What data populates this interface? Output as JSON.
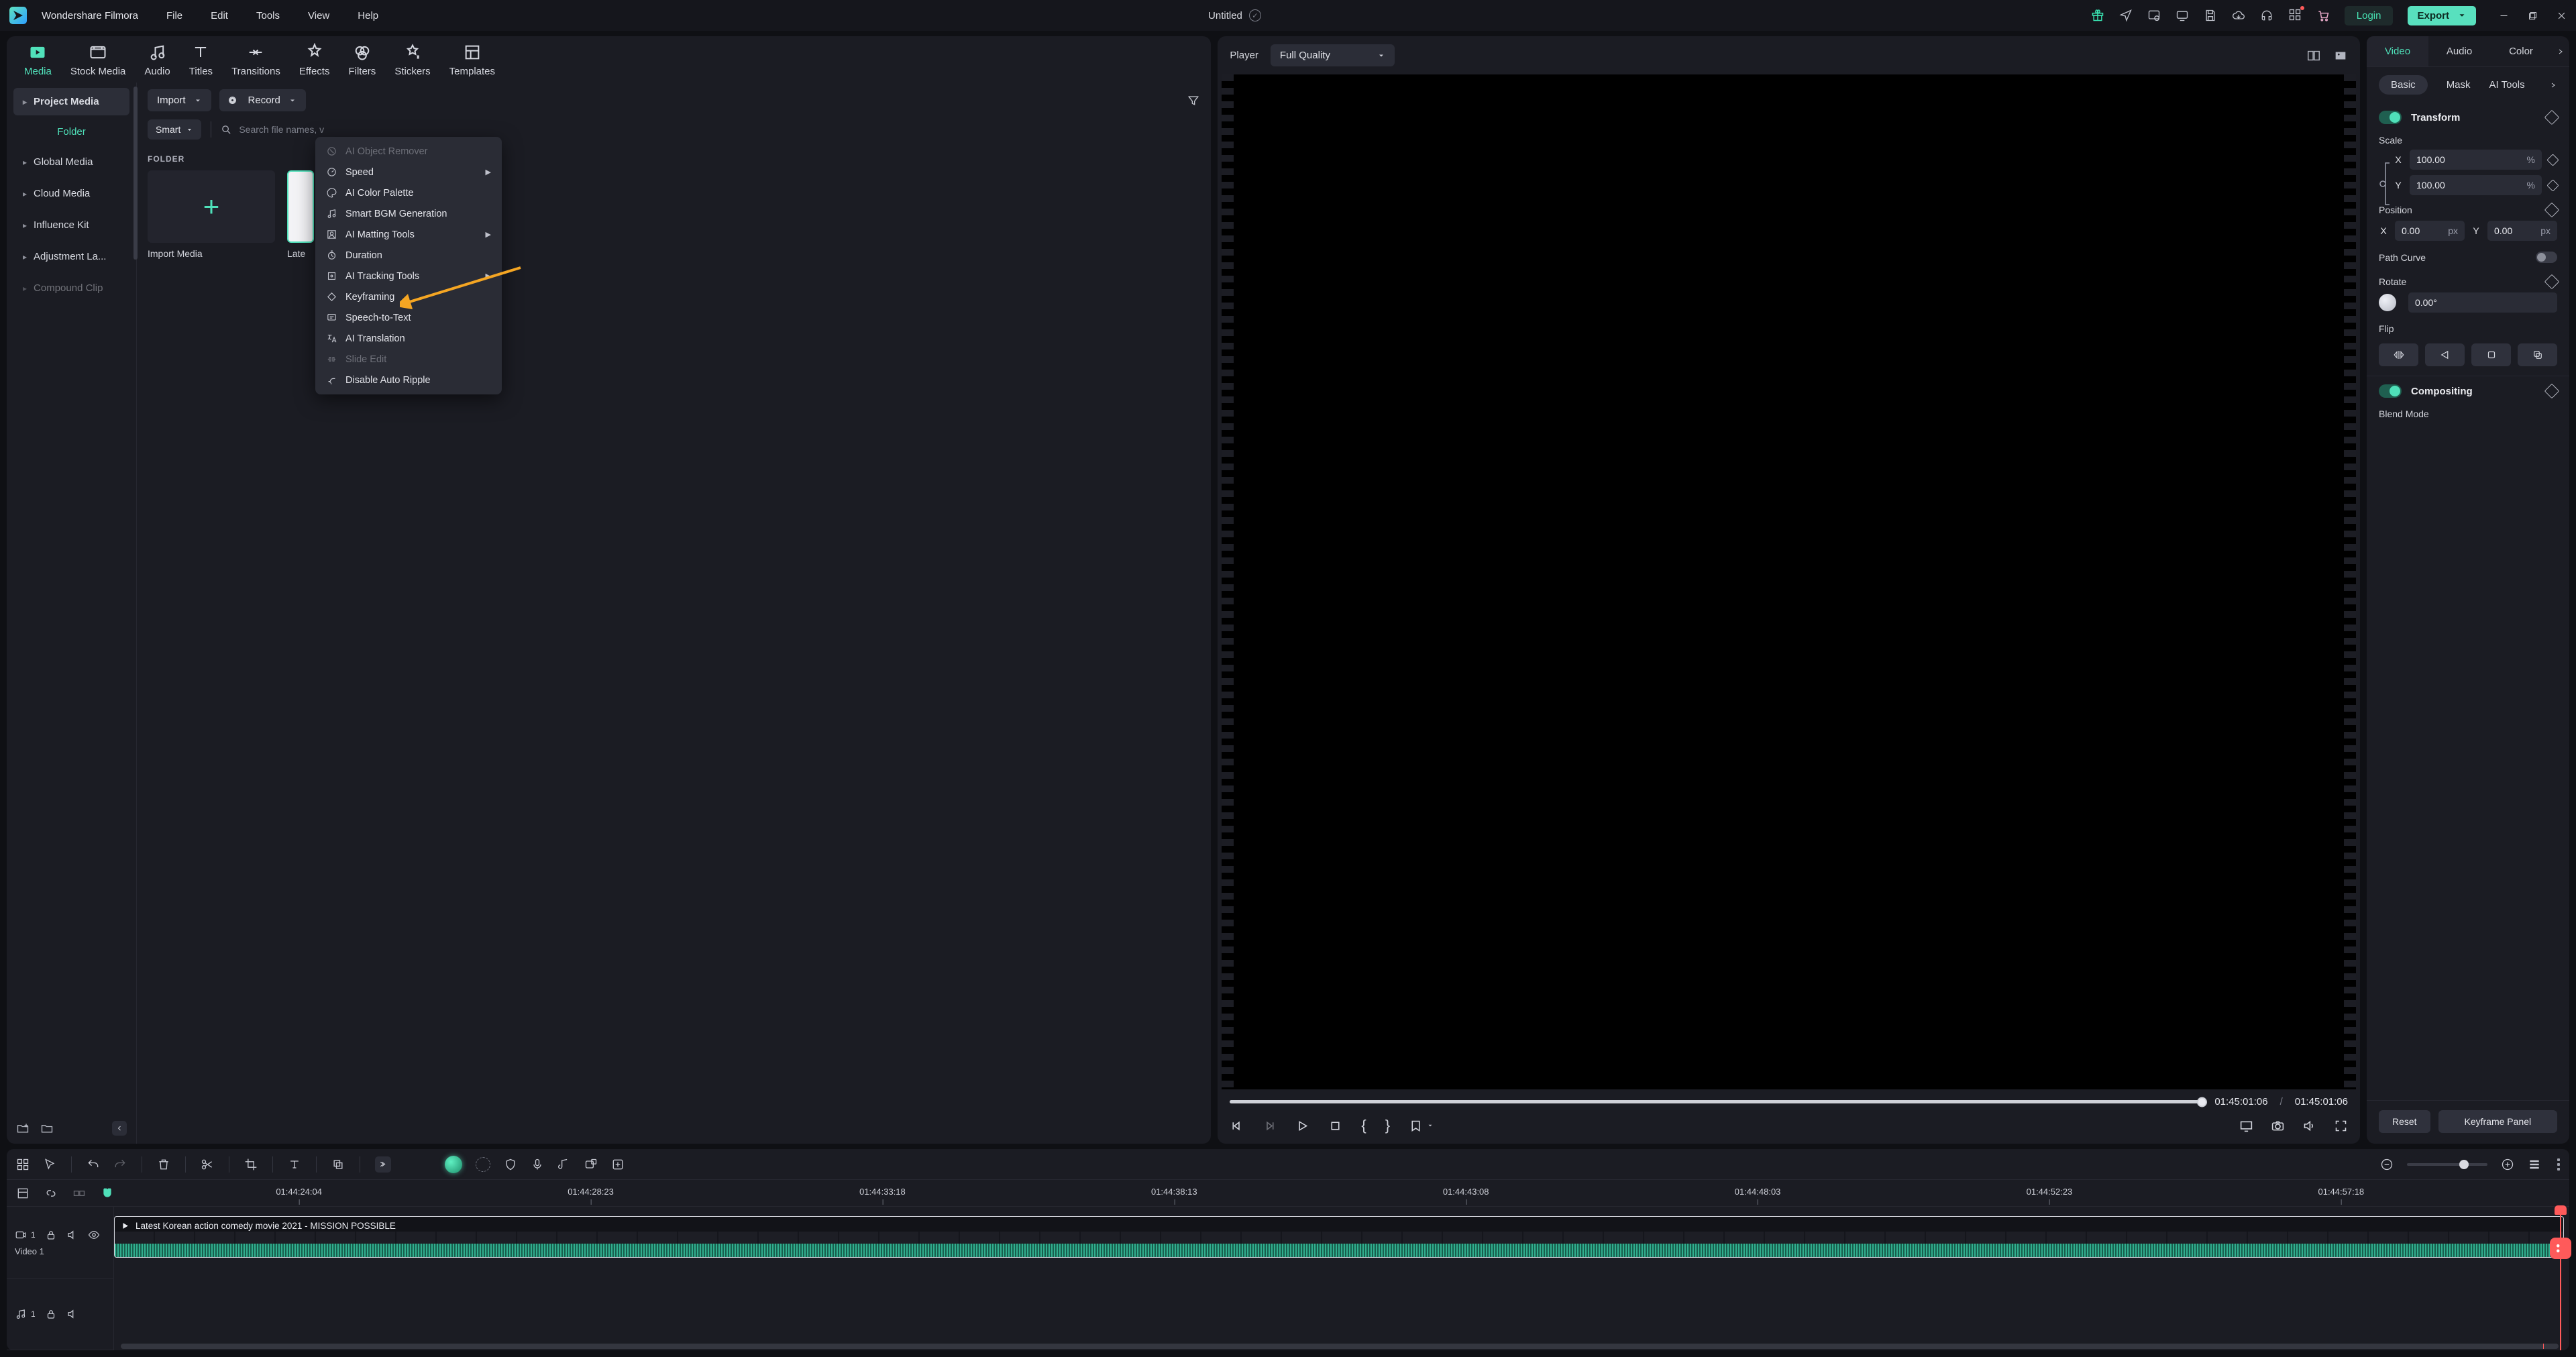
{
  "app": {
    "name": "Wondershare Filmora",
    "document": "Untitled"
  },
  "menubar": [
    "File",
    "Edit",
    "Tools",
    "View",
    "Help"
  ],
  "titlebar_buttons": {
    "login": "Login",
    "export": "Export"
  },
  "top_tabs": [
    "Media",
    "Stock Media",
    "Audio",
    "Titles",
    "Transitions",
    "Effects",
    "Filters",
    "Stickers",
    "Templates"
  ],
  "sidebar": {
    "items": [
      "Project Media",
      "Folder",
      "Global Media",
      "Cloud Media",
      "Influence Kit",
      "Adjustment La...",
      "Compound Clip"
    ]
  },
  "browser": {
    "import": "Import",
    "record": "Record",
    "smart": "Smart",
    "search_placeholder": "Search file names, v",
    "folder_label": "FOLDER",
    "thumb1_caption": "Import Media",
    "thumb2_caption": "Late"
  },
  "context_menu": [
    {
      "label": "AI Object Remover",
      "disabled": true
    },
    {
      "label": "Speed",
      "sub": true
    },
    {
      "label": "AI Color Palette"
    },
    {
      "label": "Smart BGM Generation"
    },
    {
      "label": "AI Matting Tools",
      "sub": true
    },
    {
      "label": "Duration"
    },
    {
      "label": "AI Tracking Tools",
      "sub": true
    },
    {
      "label": "Keyframing"
    },
    {
      "label": "Speech-to-Text"
    },
    {
      "label": "AI Translation"
    },
    {
      "label": "Slide Edit",
      "disabled": true
    },
    {
      "label": "Disable Auto Ripple"
    }
  ],
  "player": {
    "label": "Player",
    "quality": "Full Quality",
    "time_current": "01:45:01:06",
    "time_total": "01:45:01:06"
  },
  "inspector": {
    "tabs": [
      "Video",
      "Audio",
      "Color"
    ],
    "subtabs": [
      "Basic",
      "Mask",
      "AI Tools"
    ],
    "transform": "Transform",
    "scale": "Scale",
    "scale_x": "100.00",
    "scale_y": "100.00",
    "scale_unit": "%",
    "position": "Position",
    "pos_x": "0.00",
    "pos_y": "0.00",
    "pos_unit": "px",
    "pathcurve": "Path Curve",
    "rotate": "Rotate",
    "rotate_val": "0.00°",
    "flip": "Flip",
    "compositing": "Compositing",
    "blend": "Blend Mode",
    "reset": "Reset",
    "keyframe": "Keyframe Panel"
  },
  "timeline": {
    "ticks": [
      "01:44:24:04",
      "01:44:28:23",
      "01:44:33:18",
      "01:44:38:13",
      "01:44:43:08",
      "01:44:48:03",
      "01:44:52:23",
      "01:44:57:18"
    ],
    "video_track": "Video 1",
    "clip_title": "Latest Korean action comedy movie 2021 - MISSION POSSIBLE",
    "video_badge": "1",
    "audio_badge": "1"
  }
}
